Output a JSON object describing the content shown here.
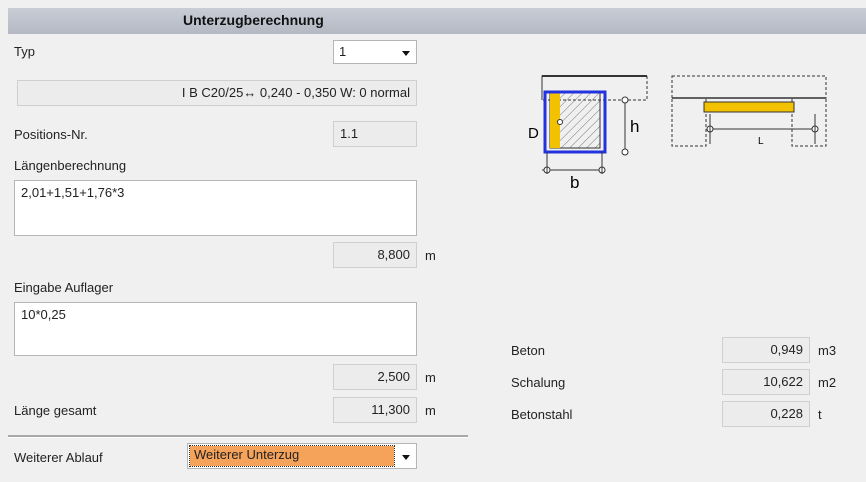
{
  "title": "Unterzugberechnung",
  "typ": {
    "label": "Typ",
    "value": "1",
    "description": "I B C20/25↔ 0,240 - 0,350 W: 0 normal"
  },
  "position": {
    "label": "Positions-Nr.",
    "value": "1.1"
  },
  "laengen": {
    "label": "Längenberechnung",
    "formula": "2,01+1,51+1,76*3",
    "result": "8,800",
    "unit": "m"
  },
  "auflager": {
    "label": "Eingabe Auflager",
    "formula": "10*0,25",
    "result": "2,500",
    "unit": "m"
  },
  "gesamt": {
    "label": "Länge gesamt",
    "value": "11,300",
    "unit": "m"
  },
  "ablauf": {
    "label": "Weiterer Ablauf",
    "value": "Weiterer Unterzug"
  },
  "results": [
    {
      "label": "Beton",
      "value": "0,949",
      "unit": "m3"
    },
    {
      "label": "Schalung",
      "value": "10,622",
      "unit": "m2"
    },
    {
      "label": "Betonstahl",
      "value": "0,228",
      "unit": "t"
    }
  ],
  "diagram": {
    "label_d": "D",
    "label_h": "h",
    "label_b": "b",
    "label_l": "L"
  },
  "colors": {
    "beam_fill": "#f2c200",
    "formwork": "#2233dd",
    "titlebar": "#bcc1cb",
    "highlight": "#f5a35a"
  }
}
